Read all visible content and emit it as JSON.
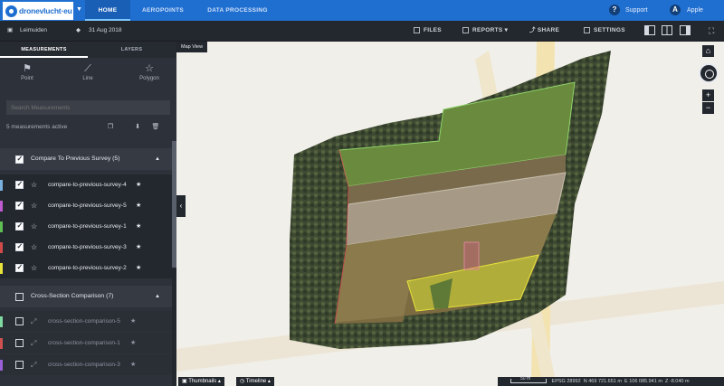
{
  "app": {
    "logo_text": "dronevlucht·eu",
    "nav_tabs": [
      "HOME",
      "AEROPOINTS",
      "DATA PROCESSING"
    ],
    "support_label": "Support",
    "user_label": "Apple",
    "user_initial": "A"
  },
  "toolbar": {
    "site_name": "Leimuiden",
    "date": "31 Aug 2018",
    "files_label": "FILES",
    "reports_label": "REPORTS",
    "share_label": "SHARE",
    "settings_label": "SETTINGS"
  },
  "sidebar": {
    "tabs": [
      "MEASUREMENTS",
      "LAYERS"
    ],
    "tools": [
      {
        "label": "Point",
        "icon": "flag-icon"
      },
      {
        "label": "Line",
        "icon": "line-icon"
      },
      {
        "label": "Polygon",
        "icon": "polygon-icon"
      }
    ],
    "search_placeholder": "Search Measurements",
    "active_count_text": "5 measurements active",
    "groups": [
      {
        "label": "Compare To Previous Survey (5)",
        "checked": true,
        "items": [
          {
            "label": "compare-to-previous-survey-4",
            "color": "#7ab0e0",
            "checked": true
          },
          {
            "label": "compare-to-previous-survey-5",
            "color": "#c05ad0",
            "checked": true
          },
          {
            "label": "compare-to-previous-survey-1",
            "color": "#5fbf52",
            "checked": true
          },
          {
            "label": "compare-to-previous-survey-3",
            "color": "#d04a4a",
            "checked": true
          },
          {
            "label": "compare-to-previous-survey-2",
            "color": "#e8e23a",
            "checked": true
          }
        ]
      },
      {
        "label": "Cross-Section Comparison (7)",
        "checked": false,
        "items": [
          {
            "label": "cross-section-comparison-5",
            "color": "#7fd9a0",
            "checked": false
          },
          {
            "label": "cross-section-comparison-1",
            "color": "#d05050",
            "checked": false
          },
          {
            "label": "cross-section-comparison-3",
            "color": "#9a60d8",
            "checked": false
          }
        ]
      }
    ]
  },
  "map": {
    "view_label": "Map View",
    "zoom_in": "+",
    "zoom_out": "−",
    "thumbnails_label": "Thumbnails",
    "timeline_label": "Timeline",
    "scale_label": "50 m",
    "epsg_label": "EPSG",
    "epsg_value": "28992",
    "n_label": "N",
    "n_value": "469 721.651 m",
    "e_label": "E",
    "e_value": "106 085.941 m",
    "z_label": "Z",
    "z_value": "-8.040 m"
  }
}
